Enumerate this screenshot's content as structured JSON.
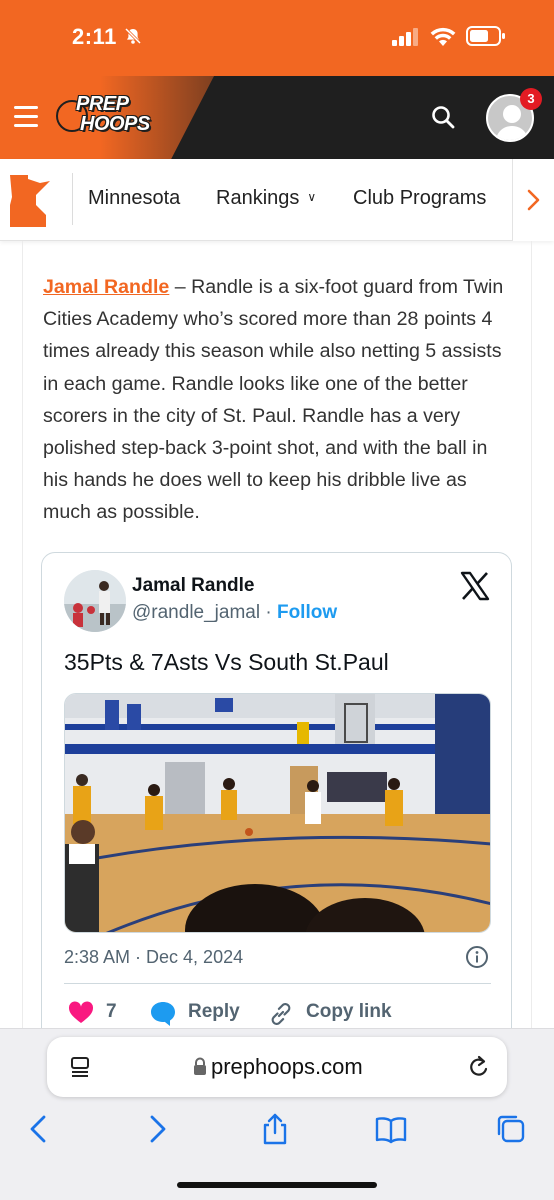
{
  "status_bar": {
    "time": "2:11"
  },
  "header": {
    "logo_text_line1": "PREP",
    "logo_text_line2": "HOOPS",
    "notification_count": "3"
  },
  "nav": {
    "state": "Minnesota",
    "rankings": "Rankings",
    "club_programs": "Club Programs"
  },
  "article": {
    "player_link": "Jamal Randle",
    "paragraph": " – Randle is a six-foot guard from Twin Cities Academy who’s scored more than 28 points 4 times already this season while also netting 5 assists in each game. Randle looks like one of the better scorers in the city of St. Paul. Randle has a very polished step-back 3-point shot, and with the ball in his hands he does well to keep his dribble live as much as possible."
  },
  "tweet": {
    "author_name": "Jamal Randle",
    "handle": "@randle_jamal",
    "separator": " · ",
    "follow_label": "Follow",
    "text": "35Pts & 7Asts Vs South St.Paul",
    "timestamp": "2:38 AM · Dec 4, 2024",
    "like_count": "7",
    "reply_label": "Reply",
    "copy_link_label": "Copy link"
  },
  "browser": {
    "url": "prephoops.com"
  },
  "colors": {
    "brand_orange": "#f26722",
    "header_dark": "#1f1f1f",
    "twitter_blue": "#1d9bf0",
    "like_pink": "#f91880"
  }
}
